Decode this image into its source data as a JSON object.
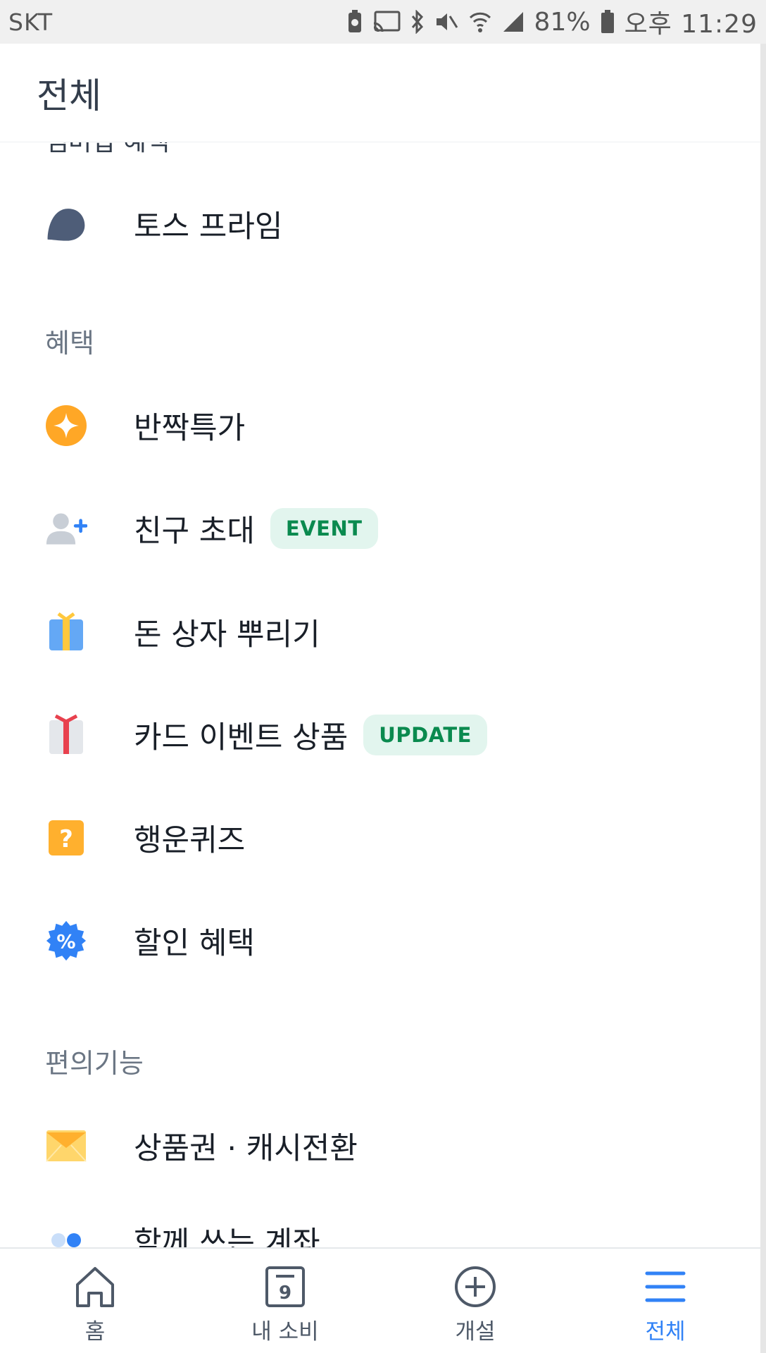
{
  "status_bar": {
    "carrier": "SKT",
    "battery_percent": "81%",
    "time": "오후 11:29"
  },
  "header": {
    "title": "전체"
  },
  "partial_top_label": "멤버십 혜택",
  "items_top": [
    {
      "label": "토스 프라임",
      "icon": "toss-prime-icon"
    }
  ],
  "sections": [
    {
      "title": "혜택",
      "items": [
        {
          "label": "반짝특가",
          "icon": "sparkle-icon"
        },
        {
          "label": "친구 초대",
          "icon": "add-friend-icon",
          "badge": "EVENT"
        },
        {
          "label": "돈 상자 뿌리기",
          "icon": "gift-box-icon"
        },
        {
          "label": "카드 이벤트 상품",
          "icon": "present-icon",
          "badge": "UPDATE"
        },
        {
          "label": "행운퀴즈",
          "icon": "question-icon"
        },
        {
          "label": "할인 혜택",
          "icon": "discount-icon"
        }
      ]
    },
    {
      "title": "편의기능",
      "items": [
        {
          "label": "상품권 · 캐시전환",
          "icon": "envelope-icon"
        },
        {
          "label": "함께 쓰는 계좌",
          "icon": "shared-account-icon"
        }
      ]
    }
  ],
  "bottom_nav": [
    {
      "label": "홈",
      "icon": "home-icon",
      "active": false
    },
    {
      "label": "내 소비",
      "icon": "calendar-icon",
      "calendar_day": "9",
      "active": false
    },
    {
      "label": "개설",
      "icon": "plus-circle-icon",
      "active": false
    },
    {
      "label": "전체",
      "icon": "menu-icon",
      "active": true
    }
  ],
  "colors": {
    "accent": "#3182f6",
    "badge_bg": "#e2f5ee",
    "badge_text": "#0a8a4f",
    "section_text": "#6b7684",
    "orange": "#ffa726"
  }
}
